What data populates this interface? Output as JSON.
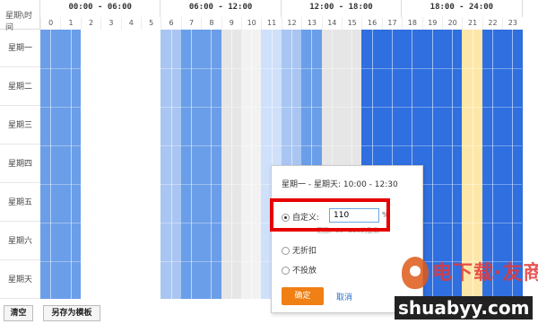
{
  "grid": {
    "corner_label": "星期\\时间",
    "periods": [
      "00:00 - 06:00",
      "06:00 - 12:00",
      "12:00 - 18:00",
      "18:00 - 24:00"
    ],
    "hours": [
      "0",
      "1",
      "2",
      "3",
      "4",
      "5",
      "6",
      "7",
      "8",
      "9",
      "10",
      "11",
      "12",
      "13",
      "14",
      "15",
      "16",
      "17",
      "18",
      "19",
      "20",
      "21",
      "22",
      "23"
    ],
    "days": [
      "星期一",
      "星期二",
      "星期三",
      "星期四",
      "星期五",
      "星期六",
      "星期天"
    ],
    "hour_colors": [
      "#6b9ee8",
      "#6b9ee8",
      "#ffffff",
      "#ffffff",
      "#ffffff",
      "#ffffff",
      "#a9c6f2",
      "#6b9ee8",
      "#6b9ee8",
      "#e6e6e6",
      "#f2f2f2",
      "#cfe0fb",
      "#a9c6f2",
      "#6b9ee8",
      "#e6e6e6",
      "#e6e6e6",
      "#2f6fe0",
      "#2f6fe0",
      "#2f6fe0",
      "#2f6fe0",
      "#2f6fe0",
      "#fde7a8",
      "#2f6fe0",
      "#2f6fe0"
    ]
  },
  "buttons": {
    "clear": "清空",
    "save_template": "另存为模板"
  },
  "popup": {
    "time_range": "星期一 - 星期天:  10:00 - 12:30",
    "custom_label": "自定义:",
    "custom_value": "110",
    "percent_sign": "%",
    "hint": "范围：30~250的整数",
    "no_discount_label": "无折扣",
    "no_serve_label": "不投放",
    "ok_label": "确定",
    "cancel_label": "取消"
  },
  "watermark": {
    "brand_text": "电下载·友商网",
    "url_text": "shuabyy.com"
  }
}
